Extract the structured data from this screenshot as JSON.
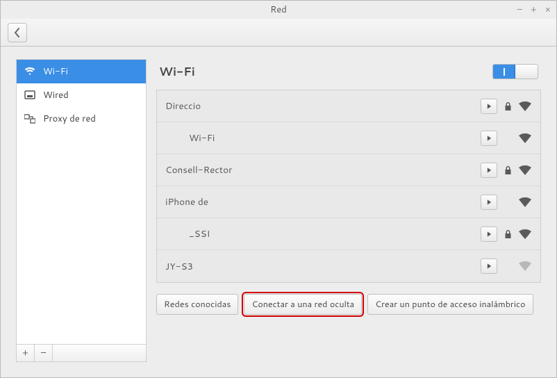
{
  "window": {
    "title": "Red"
  },
  "sidebar": {
    "items": [
      {
        "id": "wifi",
        "label": "Wi-Fi",
        "selected": true
      },
      {
        "id": "wired",
        "label": "Wired",
        "selected": false
      },
      {
        "id": "proxy",
        "label": "Proxy de red",
        "selected": false
      }
    ]
  },
  "main": {
    "title": "Wi-Fi",
    "wifi_enabled": true
  },
  "networks": [
    {
      "name": "Direccio",
      "secured": true,
      "signal": "strong"
    },
    {
      "name": "Wi-Fi",
      "secured": false,
      "signal": "strong"
    },
    {
      "name": "Consell-Rector",
      "secured": true,
      "signal": "strong"
    },
    {
      "name": "iPhone de",
      "secured": false,
      "signal": "strong"
    },
    {
      "name": "_SSI",
      "secured": true,
      "signal": "mid"
    },
    {
      "name": "JY-S3",
      "secured": false,
      "signal": "weak"
    }
  ],
  "buttons": {
    "known": "Redes conocidas",
    "hidden": "Conectar a una red oculta",
    "hotspot": "Crear un punto de acceso inalámbrico"
  }
}
